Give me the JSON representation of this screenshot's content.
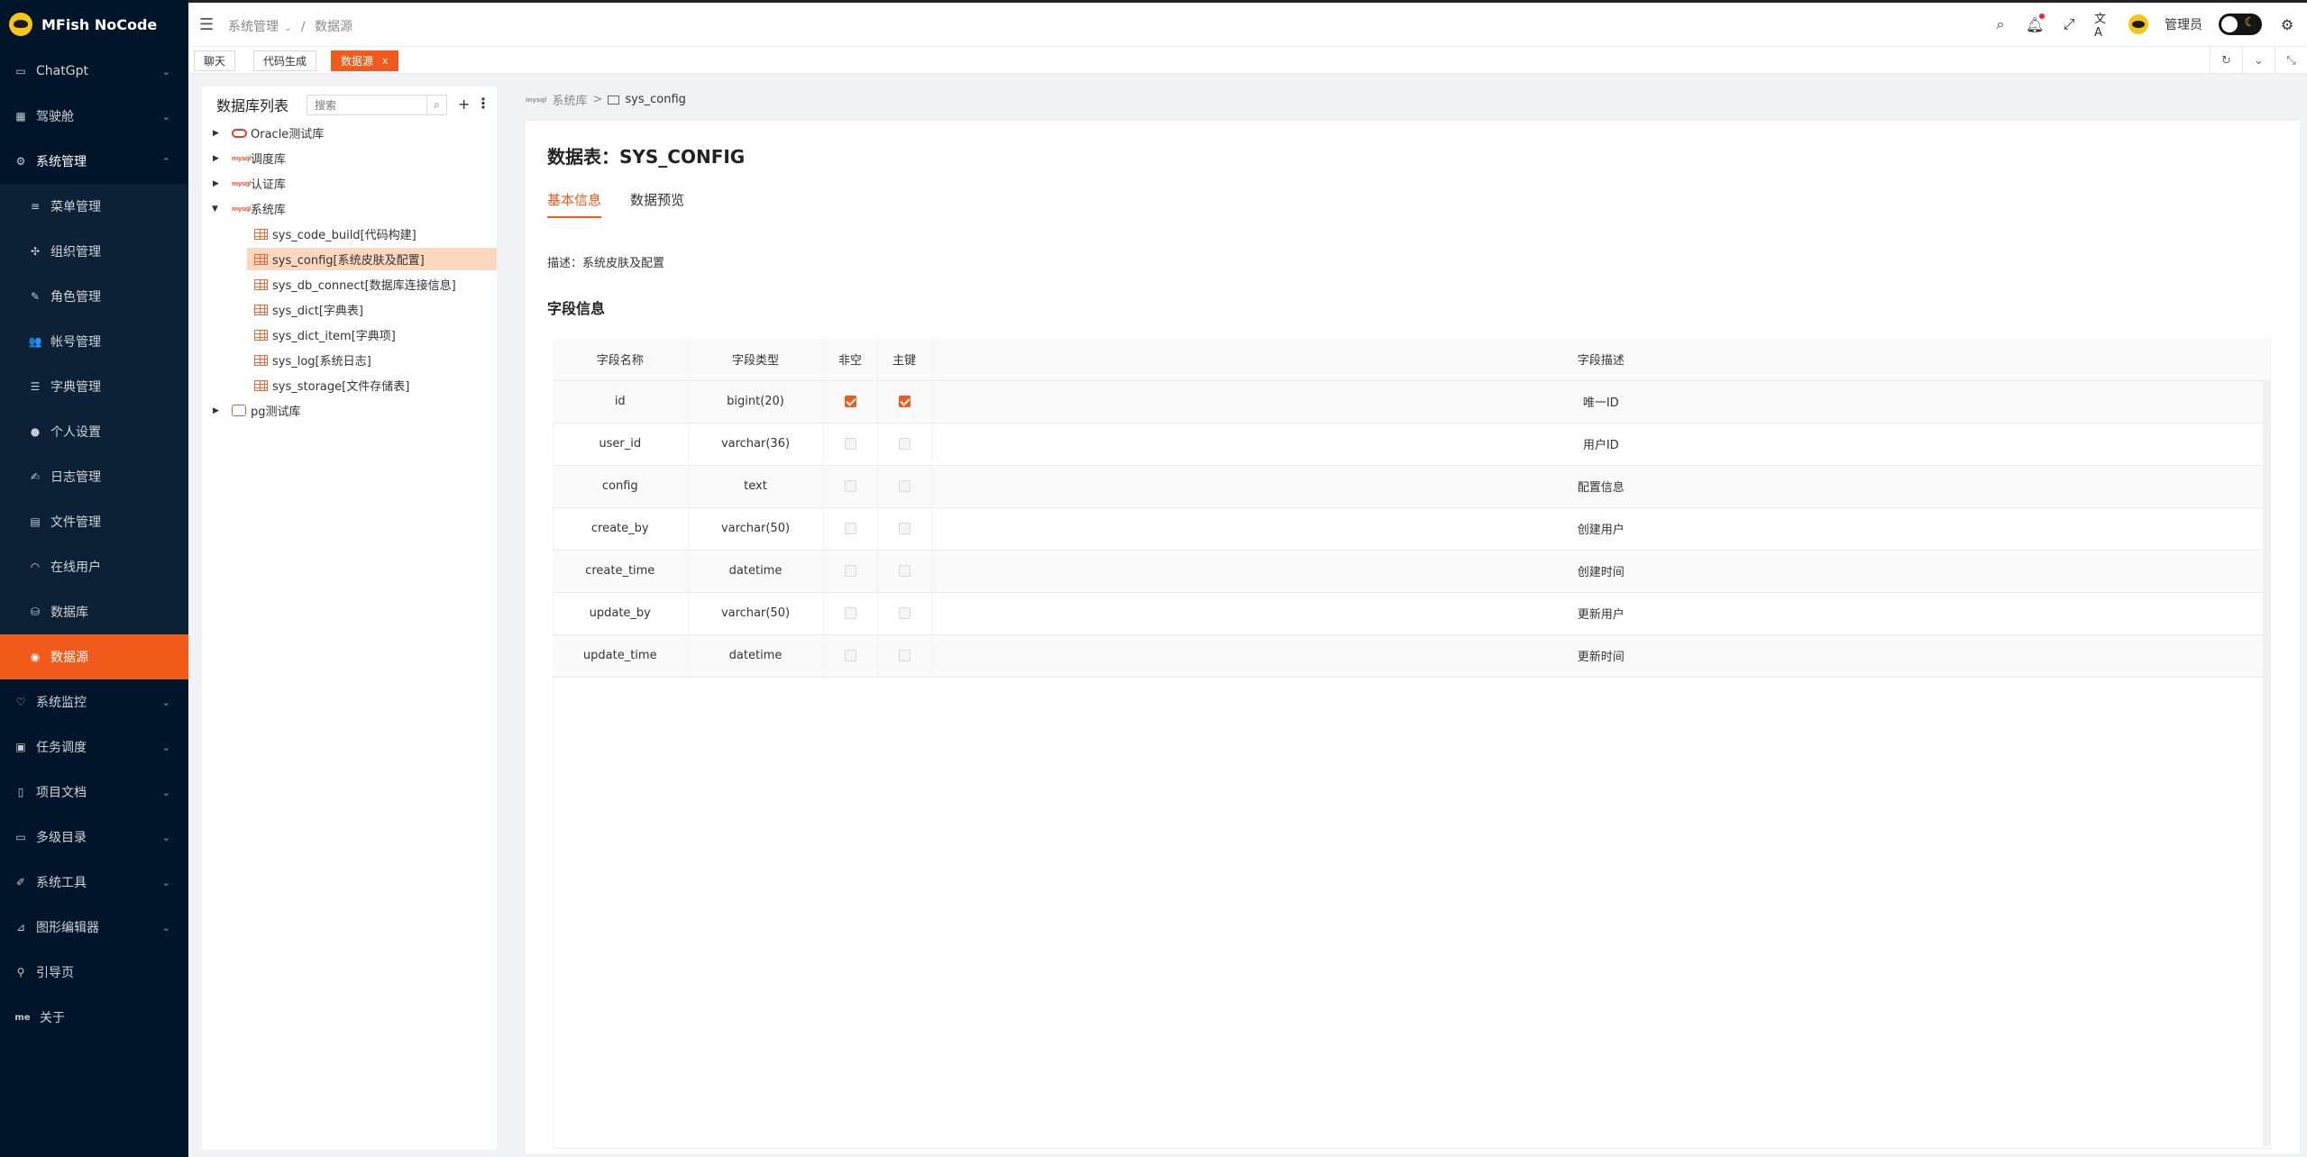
{
  "app": {
    "name": "MFish NoCode"
  },
  "sidebar": {
    "items": [
      {
        "label": "ChatGpt",
        "icon": "chat-icon",
        "has_children": true
      },
      {
        "label": "驾驶舱",
        "icon": "dashboard-icon",
        "has_children": true
      },
      {
        "label": "系统管理",
        "icon": "gear-icon",
        "has_children": true,
        "expanded": true
      },
      {
        "label": "系统监控",
        "icon": "monitor-icon",
        "has_children": true
      },
      {
        "label": "任务调度",
        "icon": "schedule-icon",
        "has_children": true
      },
      {
        "label": "项目文档",
        "icon": "book-icon",
        "has_children": true
      },
      {
        "label": "多级目录",
        "icon": "folder-icon",
        "has_children": true
      },
      {
        "label": "系统工具",
        "icon": "tool-icon",
        "has_children": true
      },
      {
        "label": "图形编辑器",
        "icon": "chart-icon",
        "has_children": true
      },
      {
        "label": "引导页",
        "icon": "guide-icon",
        "has_children": false
      },
      {
        "label": "关于",
        "icon": "me-icon",
        "icon_text": "me",
        "has_children": false
      }
    ],
    "system_children": [
      {
        "label": "菜单管理",
        "icon": "menu-icon"
      },
      {
        "label": "组织管理",
        "icon": "org-icon"
      },
      {
        "label": "角色管理",
        "icon": "role-icon"
      },
      {
        "label": "帐号管理",
        "icon": "users-icon"
      },
      {
        "label": "字典管理",
        "icon": "list-icon"
      },
      {
        "label": "个人设置",
        "icon": "user-icon"
      },
      {
        "label": "日志管理",
        "icon": "log-icon"
      },
      {
        "label": "文件管理",
        "icon": "file-icon"
      },
      {
        "label": "在线用户",
        "icon": "wifi-icon"
      },
      {
        "label": "数据库",
        "icon": "database-icon"
      },
      {
        "label": "数据源",
        "icon": "datasource-icon",
        "selected": true
      }
    ]
  },
  "header": {
    "breadcrumb": [
      "系统管理",
      "数据源"
    ],
    "user_name": "管理员"
  },
  "tabs": [
    {
      "label": "聊天",
      "active": false
    },
    {
      "label": "代码生成",
      "active": false
    },
    {
      "label": "数据源",
      "active": true,
      "close": "x"
    }
  ],
  "left_panel": {
    "title": "数据库列表",
    "search_placeholder": "搜索",
    "tree": [
      {
        "label": "Oracle测试库",
        "level": 0,
        "icon": "oracle-icon",
        "caret": "right"
      },
      {
        "label": "调度库",
        "level": 0,
        "icon": "mysql-icon",
        "caret": "right"
      },
      {
        "label": "认证库",
        "level": 0,
        "icon": "mysql-icon",
        "caret": "right"
      },
      {
        "label": "系统库",
        "level": 0,
        "icon": "mysql-icon",
        "caret": "down"
      },
      {
        "label": "sys_code_build[代码构建]",
        "level": 1,
        "icon": "table-icon"
      },
      {
        "label": "sys_config[系统皮肤及配置]",
        "level": 1,
        "icon": "table-icon",
        "selected": true
      },
      {
        "label": "sys_db_connect[数据库连接信息]",
        "level": 1,
        "icon": "table-icon"
      },
      {
        "label": "sys_dict[字典表]",
        "level": 1,
        "icon": "table-icon"
      },
      {
        "label": "sys_dict_item[字典项]",
        "level": 1,
        "icon": "table-icon"
      },
      {
        "label": "sys_log[系统日志]",
        "level": 1,
        "icon": "table-icon"
      },
      {
        "label": "sys_storage[文件存储表]",
        "level": 1,
        "icon": "table-icon"
      },
      {
        "label": "pg测试库",
        "level": 0,
        "icon": "postgres-icon",
        "caret": "right"
      }
    ]
  },
  "content": {
    "breadcrumb": [
      "系统库",
      "sys_config"
    ],
    "title": "数据表：SYS_CONFIG",
    "tabs": [
      "基本信息",
      "数据预览"
    ],
    "description": "描述：系统皮肤及配置",
    "section_title": "字段信息",
    "columns": [
      "字段名称",
      "字段类型",
      "非空",
      "主键",
      "字段描述"
    ],
    "rows": [
      {
        "name": "id",
        "type": "bigint(20)",
        "not_null": true,
        "primary": true,
        "desc": "唯一ID"
      },
      {
        "name": "user_id",
        "type": "varchar(36)",
        "not_null": false,
        "primary": false,
        "desc": "用户ID"
      },
      {
        "name": "config",
        "type": "text",
        "not_null": false,
        "primary": false,
        "desc": "配置信息"
      },
      {
        "name": "create_by",
        "type": "varchar(50)",
        "not_null": false,
        "primary": false,
        "desc": "创建用户"
      },
      {
        "name": "create_time",
        "type": "datetime",
        "not_null": false,
        "primary": false,
        "desc": "创建时间"
      },
      {
        "name": "update_by",
        "type": "varchar(50)",
        "not_null": false,
        "primary": false,
        "desc": "更新用户"
      },
      {
        "name": "update_time",
        "type": "datetime",
        "not_null": false,
        "primary": false,
        "desc": "更新时间"
      }
    ]
  },
  "colors": {
    "accent": "#f05a1a",
    "sidebar_bg": "#001529",
    "selected_row": "#fdd6bf"
  }
}
